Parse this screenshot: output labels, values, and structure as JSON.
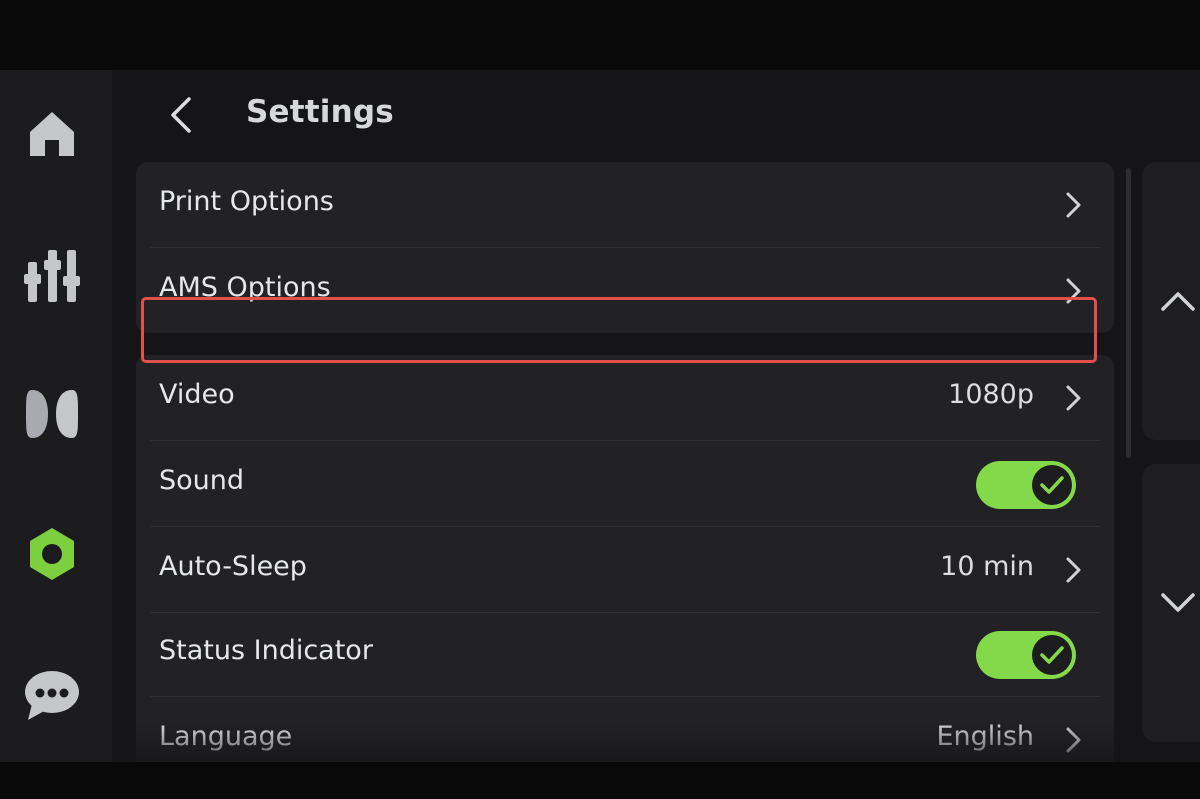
{
  "header": {
    "title": "Settings"
  },
  "nav": [
    {
      "icon": "home-icon"
    },
    {
      "icon": "sliders-icon"
    },
    {
      "icon": "filament-icon"
    },
    {
      "icon": "settings-icon",
      "active": true
    },
    {
      "icon": "chat-icon"
    }
  ],
  "settings": {
    "print_options": {
      "label": "Print Options"
    },
    "ams_options": {
      "label": "AMS Options"
    },
    "video": {
      "label": "Video",
      "value": "1080p"
    },
    "sound": {
      "label": "Sound",
      "enabled": true
    },
    "auto_sleep": {
      "label": "Auto-Sleep",
      "value": "10 min"
    },
    "status_indicator": {
      "label": "Status Indicator",
      "enabled": true
    },
    "language": {
      "label": "Language",
      "value": "English"
    }
  },
  "colors": {
    "accent": "#84d94a",
    "highlight": "#e2504d",
    "card": "#222226",
    "background": "#151518"
  }
}
